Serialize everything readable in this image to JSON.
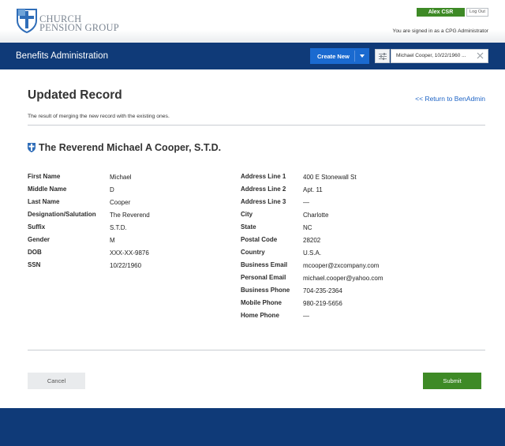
{
  "header": {
    "logo_line1": "CHURCH",
    "logo_line2": "PENSION GROUP",
    "user_label": "Alex CSR",
    "logout_label": "Log Out",
    "signed_in_text": "You are signed in as a CPG Administrator"
  },
  "nav": {
    "title": "Benefits Administration",
    "create_label": "Create New",
    "search_value": "Michael Cooper, 10/22/1960 ..."
  },
  "main": {
    "title": "Updated Record",
    "return_label": "<< Return to BenAdmin",
    "subtitle": "The result of merging the new record with the existing ones.",
    "record_name": "The Reverend Michael A Cooper, S.T.D."
  },
  "personal": [
    {
      "label": "First Name",
      "value": "Michael"
    },
    {
      "label": "Middle Name",
      "value": "D"
    },
    {
      "label": "Last Name",
      "value": "Cooper"
    },
    {
      "label": "Designation/Salutation",
      "value": "The Reverend"
    },
    {
      "label": "Suffix",
      "value": "S.T.D."
    },
    {
      "label": "Gender",
      "value": "M"
    },
    {
      "label": "DOB",
      "value": "XXX-XX-9876"
    },
    {
      "label": "SSN",
      "value": "10/22/1960"
    }
  ],
  "contact": [
    {
      "label": "Address Line 1",
      "value": "400 E Stonewall St"
    },
    {
      "label": "Address Line 2",
      "value": "Apt. 11"
    },
    {
      "label": "Address Line 3",
      "value": "—"
    },
    {
      "label": "City",
      "value": "Charlotte"
    },
    {
      "label": "State",
      "value": "NC"
    },
    {
      "label": "Postal Code",
      "value": "28202"
    },
    {
      "label": "Country",
      "value": "U.S.A."
    },
    {
      "label": "Business Email",
      "value": "mcooper@zxcompany.com"
    },
    {
      "label": "Personal Email",
      "value": "michael.cooper@yahoo.com"
    },
    {
      "label": "Business Phone",
      "value": "704-235-2364"
    },
    {
      "label": "Mobile Phone",
      "value": "980-219-5656"
    },
    {
      "label": "Home Phone",
      "value": "—"
    }
  ],
  "actions": {
    "cancel_label": "Cancel",
    "submit_label": "Submit"
  },
  "colors": {
    "brand_navy": "#0f3a78",
    "accent_blue": "#1a6ad0",
    "success_green": "#3e8a26",
    "link_blue": "#1f65c6"
  }
}
